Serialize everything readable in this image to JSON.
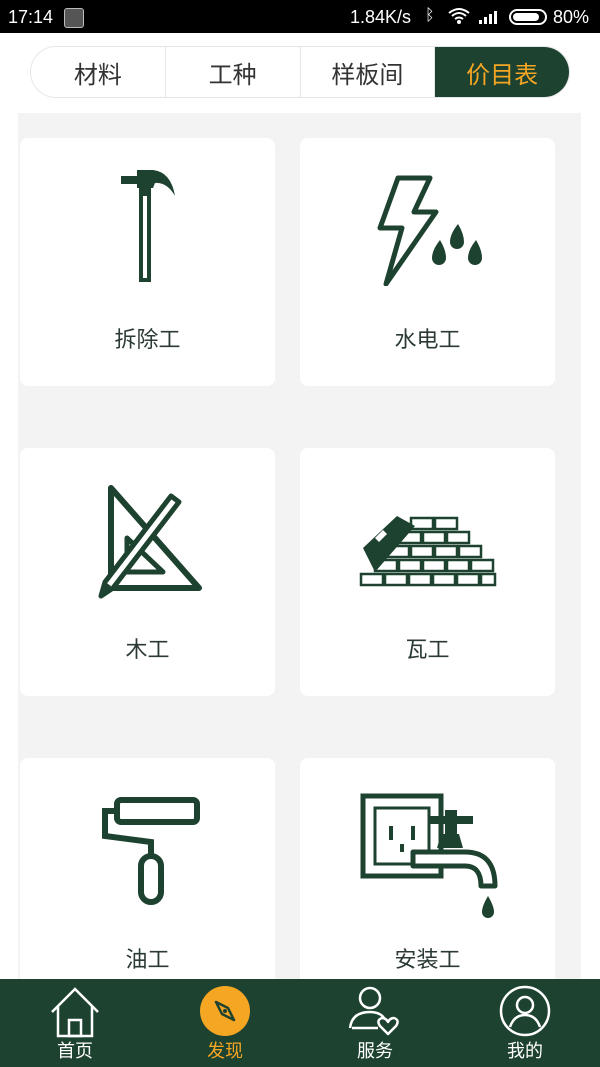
{
  "status_bar": {
    "time": "17:14",
    "net_speed": "1.84K/s",
    "battery": "80%"
  },
  "tabs": [
    {
      "label": "材料",
      "active": false
    },
    {
      "label": "工种",
      "active": false
    },
    {
      "label": "样板间",
      "active": false
    },
    {
      "label": "价目表",
      "active": true
    }
  ],
  "trades": [
    {
      "label": "拆除工",
      "icon": "hammer-icon"
    },
    {
      "label": "水电工",
      "icon": "lightning-water-icon"
    },
    {
      "label": "木工",
      "icon": "carpentry-square-icon"
    },
    {
      "label": "瓦工",
      "icon": "brick-wall-icon"
    },
    {
      "label": "油工",
      "icon": "paint-roller-icon"
    },
    {
      "label": "安装工",
      "icon": "socket-faucet-icon"
    }
  ],
  "bottom_nav": [
    {
      "label": "首页",
      "icon": "home-icon",
      "active": false
    },
    {
      "label": "发现",
      "icon": "compass-icon",
      "active": true
    },
    {
      "label": "服务",
      "icon": "user-heart-icon",
      "active": false
    },
    {
      "label": "我的",
      "icon": "profile-icon",
      "active": false
    }
  ],
  "colors": {
    "brand_dark_green": "#1e4230",
    "accent_orange": "#f5a623",
    "icon_green": "#1e4230"
  }
}
